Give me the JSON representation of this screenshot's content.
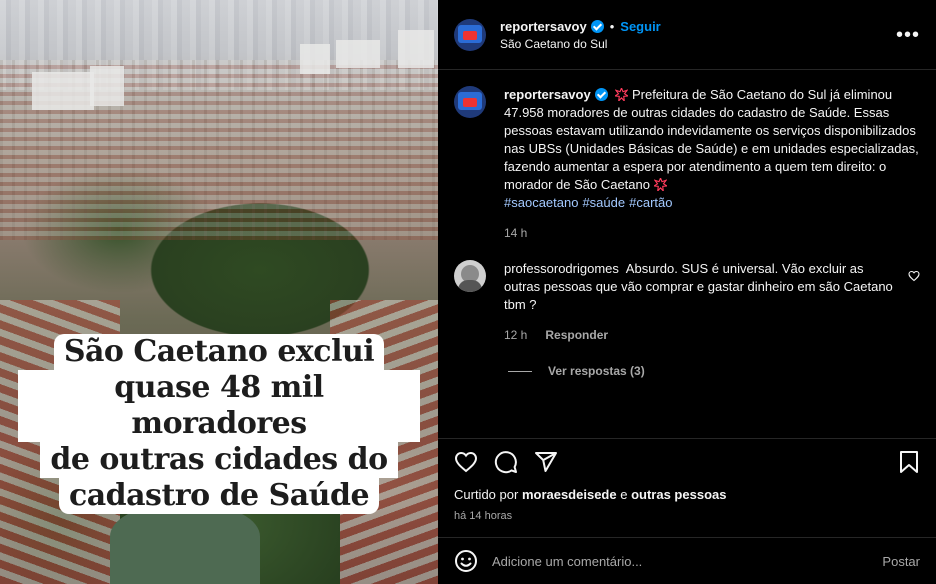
{
  "image": {
    "caption_lines": [
      "São Caetano exclui",
      "quase 48 mil moradores",
      "de outras cidades do",
      "cadastro de Saúde"
    ]
  },
  "header": {
    "username": "reportersavoy",
    "separator": "•",
    "follow_label": "Seguir",
    "location": "São Caetano do Sul",
    "more_label": "•••"
  },
  "post": {
    "username": "reportersavoy",
    "text": "Prefeitura de São Caetano do Sul já eliminou 47.958 moradores de outras cidades do cadastro de Saúde. Essas pessoas estavam utilizando indevidamente os serviços disponibilizados nas UBSs (Unidades Básicas de Saúde) e em unidades especializadas, fazendo aumentar a espera por atendimento a quem tem direito: o morador de São Caetano",
    "hashtags": [
      "#saocaetano",
      "#saúde",
      "#cartão"
    ],
    "age": "14 h"
  },
  "comment": {
    "username": "professorodrigomes",
    "text": "Absurdo. SUS é universal. Vão excluir as outras pessoas que vão comprar e gastar dinheiro em são Caetano tbm ?",
    "age": "12 h",
    "reply_label": "Responder",
    "view_replies": "Ver respostas (3)"
  },
  "likes": {
    "prefix": "Curtido por",
    "user": "moraesdeisede",
    "joiner": "e",
    "others": "outras pessoas",
    "time": "há 14 horas"
  },
  "composer": {
    "placeholder": "Adicione um comentário...",
    "post_label": "Postar"
  },
  "colors": {
    "accent": "#0095f6",
    "hashtag": "#a3c9ff",
    "muted": "#a8a8a8",
    "background": "#000000"
  },
  "icons": [
    "verified-icon",
    "more-icon",
    "alert-emoji-icon",
    "heart-icon",
    "comment-icon",
    "share-icon",
    "bookmark-icon",
    "emoji-icon"
  ]
}
